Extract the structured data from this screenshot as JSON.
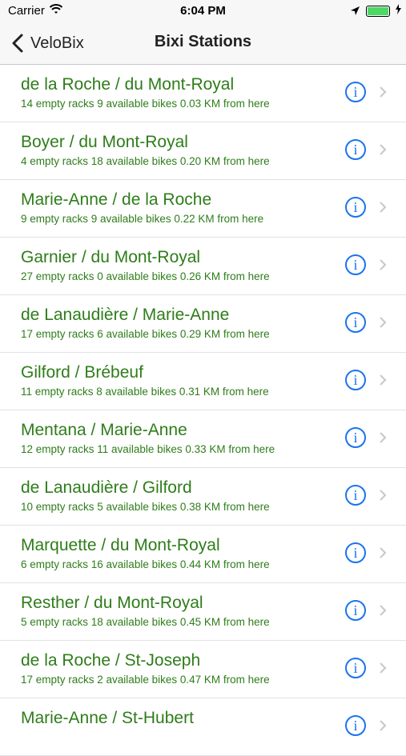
{
  "status": {
    "carrier": "Carrier",
    "time": "6:04 PM"
  },
  "nav": {
    "back_label": "VeloBix",
    "title": "Bixi Stations"
  },
  "stations": [
    {
      "name": "de la Roche / du Mont-Royal",
      "detail": "14 empty racks 9 available bikes   0.03 KM from here"
    },
    {
      "name": "Boyer / du Mont-Royal",
      "detail": "4 empty racks 18 available bikes   0.20 KM from here"
    },
    {
      "name": "Marie-Anne / de la Roche",
      "detail": "9 empty racks 9 available bikes   0.22 KM from here"
    },
    {
      "name": "Garnier / du Mont-Royal",
      "detail": "27 empty racks 0 available bikes   0.26 KM from here"
    },
    {
      "name": "de Lanaudière / Marie-Anne",
      "detail": "17 empty racks 6 available bikes   0.29 KM from here"
    },
    {
      "name": "Gilford / Brébeuf",
      "detail": "11 empty racks 8 available bikes   0.31 KM from here"
    },
    {
      "name": "Mentana / Marie-Anne",
      "detail": "12 empty racks 11 available bikes   0.33 KM from here"
    },
    {
      "name": "de Lanaudière / Gilford",
      "detail": "10 empty racks 5 available bikes   0.38 KM from here"
    },
    {
      "name": "Marquette / du Mont-Royal",
      "detail": "6 empty racks 16 available bikes   0.44 KM from here"
    },
    {
      "name": "Resther / du Mont-Royal",
      "detail": "5 empty racks 18 available bikes   0.45 KM from here"
    },
    {
      "name": "de la Roche / St-Joseph",
      "detail": "17 empty racks 2 available bikes   0.47 KM from here"
    },
    {
      "name": "Marie-Anne / St-Hubert",
      "detail": ""
    }
  ],
  "icons": {
    "info": "i"
  },
  "colors": {
    "station_text": "#2e7d1a",
    "info_accent": "#1a74f0"
  }
}
